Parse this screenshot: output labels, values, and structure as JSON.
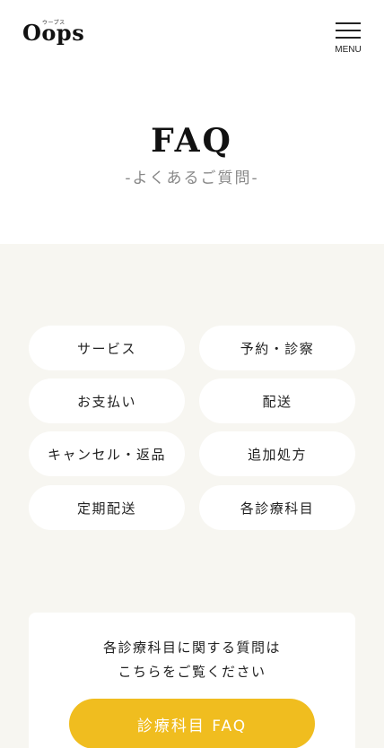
{
  "header": {
    "logo": "Oops",
    "logo_ruby": "ウープス",
    "menu_label": "MENU"
  },
  "page": {
    "title": "FAQ",
    "subtitle": "-よくあるご質問-"
  },
  "categories": [
    {
      "label": "サービス"
    },
    {
      "label": "予約・診察"
    },
    {
      "label": "お支払い"
    },
    {
      "label": "配送"
    },
    {
      "label": "キャンセル・返品"
    },
    {
      "label": "追加処方"
    },
    {
      "label": "定期配送"
    },
    {
      "label": "各診療科目"
    }
  ],
  "card": {
    "line1": "各診療科目に関する質問は",
    "line2": "こちらをご覧ください",
    "button_label": "診療科目 FAQ"
  },
  "colors": {
    "accent": "#f0bd1f",
    "background": "#f7f6f1"
  }
}
